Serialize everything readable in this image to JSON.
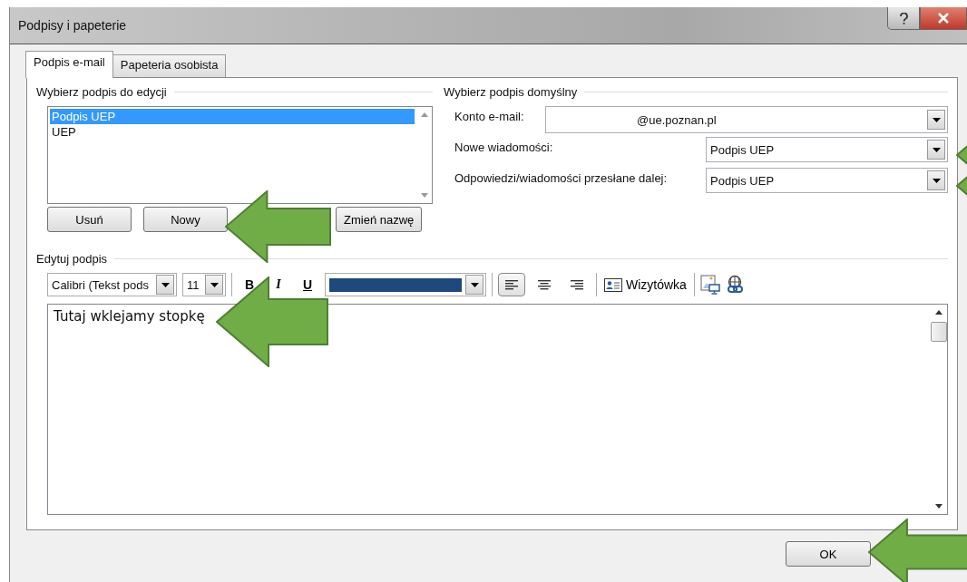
{
  "window": {
    "title": "Podpisy i papeterie"
  },
  "tabs": [
    {
      "label": "Podpis e-mail",
      "selected": true
    },
    {
      "label": "Papeteria osobista",
      "selected": false
    }
  ],
  "edit_section": {
    "heading": "Wybierz podpis do edycji",
    "signatures": [
      {
        "name": "Podpis UEP",
        "selected": true
      },
      {
        "name": "UEP",
        "selected": false
      }
    ],
    "buttons": [
      "Usuń",
      "Nowy",
      "Zmień nazwę"
    ]
  },
  "default_section": {
    "heading": "Wybierz podpis domyślny",
    "fields": [
      {
        "label": "Konto e-mail:",
        "value": "@ue.poznan.pl",
        "kind": "wide"
      },
      {
        "label": "Nowe wiadomości:",
        "value": "Podpis UEP",
        "kind": "narrow"
      },
      {
        "label": "Odpowiedzi/wiadomości przesłane dalej:",
        "value": "Podpis UEP",
        "kind": "narrow"
      }
    ]
  },
  "editor": {
    "heading": "Edytuj podpis",
    "font": "Calibri (Tekst pods",
    "size": "11",
    "format_buttons": [
      {
        "label": "B",
        "kind": "bold"
      },
      {
        "label": "I",
        "kind": "italic"
      },
      {
        "label": "U",
        "kind": "underline"
      }
    ],
    "alignments": [
      {
        "kind": "left",
        "selected": true
      },
      {
        "kind": "center",
        "selected": false
      },
      {
        "kind": "right",
        "selected": false
      }
    ],
    "card_button": "Wizytówka",
    "text": "Tutaj wklejamy stopkę"
  },
  "buttons": [
    "OK"
  ]
}
